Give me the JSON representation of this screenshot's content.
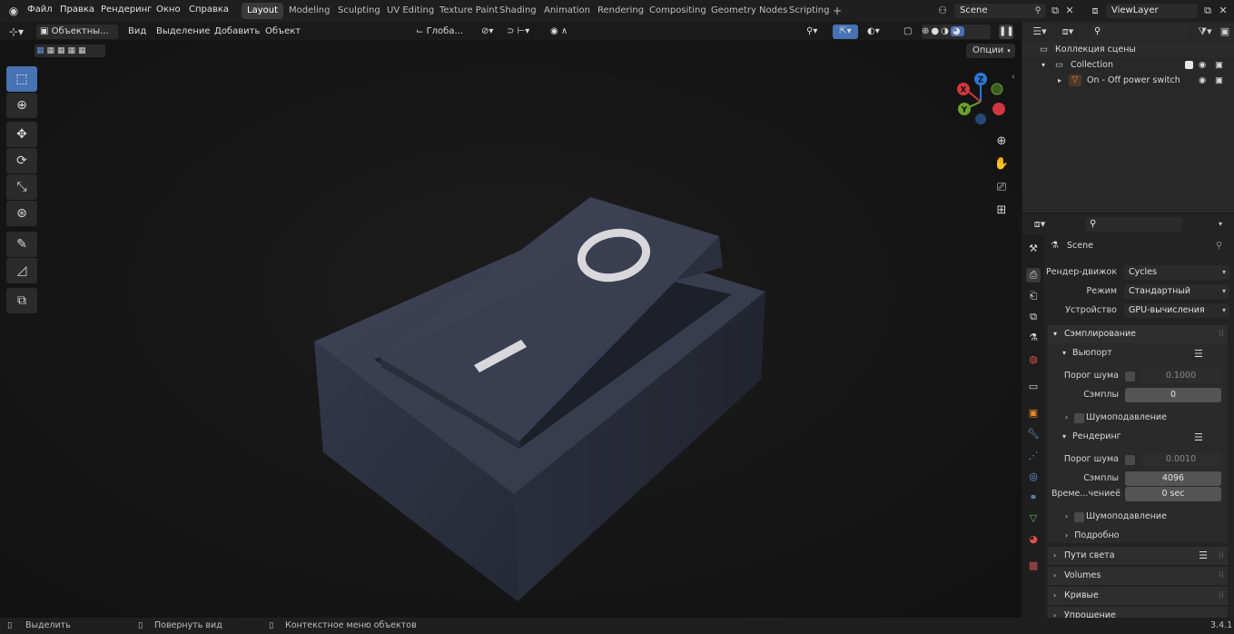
{
  "menu": [
    "Файл",
    "Правка",
    "Рендеринг",
    "Окно",
    "Справка"
  ],
  "workspaces": [
    "Layout",
    "Modeling",
    "Sculpting",
    "UV Editing",
    "Texture Paint",
    "Shading",
    "Animation",
    "Rendering",
    "Compositing",
    "Geometry Nodes",
    "Scripting"
  ],
  "active_workspace": "Layout",
  "add_tab": "+",
  "scene_name": "Scene",
  "view_layer": "ViewLayer",
  "viewport_header": {
    "mode": "Объектны...",
    "view": "Вид",
    "select": "Выделение",
    "add": "Добавить",
    "object": "Объект",
    "transform_orientation": "Глоба...",
    "options": "Опции"
  },
  "outliner": {
    "search_placeholder": "",
    "scene_collection": "Коллекция сцены",
    "collection": "Collection",
    "object": "On - Off power switch"
  },
  "model": {
    "off_symbol": "O",
    "on_symbol": "I"
  },
  "properties": {
    "context": "Scene",
    "render_engine_label": "Рендер-движок",
    "render_engine": "Cycles",
    "mode_label": "Режим",
    "mode": "Стандартный",
    "device_label": "Устройство",
    "device": "GPU-вычисления",
    "sampling": "Сэмплирование",
    "viewport": "Вьюпорт",
    "noise_threshold_label": "Порог шума",
    "viewport_noise_threshold": "0.1000",
    "samples_label": "Сэмплы",
    "viewport_samples": "0",
    "denoise": "Шумоподавление",
    "render": "Рендеринг",
    "render_noise_threshold": "0.0010",
    "render_samples": "4096",
    "time_limit_label": "Време...чениеё",
    "time_limit": "0 sec",
    "render_denoise": "Шумоподавление",
    "advanced": "Подробно",
    "light_paths": "Пути света",
    "volumes": "Volumes",
    "curves": "Кривые",
    "simplify": "Упрощение"
  },
  "status": {
    "select": "Выделить",
    "rotate_view": "Повернуть вид",
    "context_menu": "Контекстное меню объектов",
    "version": "3.4.1"
  },
  "gizmo": {
    "x": "X",
    "y": "Y",
    "z": "Z"
  },
  "colors": {
    "accent": "#4772b3",
    "x_axis": "#d3363e",
    "y_axis": "#6ba22b",
    "z_axis": "#2c78d8",
    "object_orange": "#e8892c"
  }
}
